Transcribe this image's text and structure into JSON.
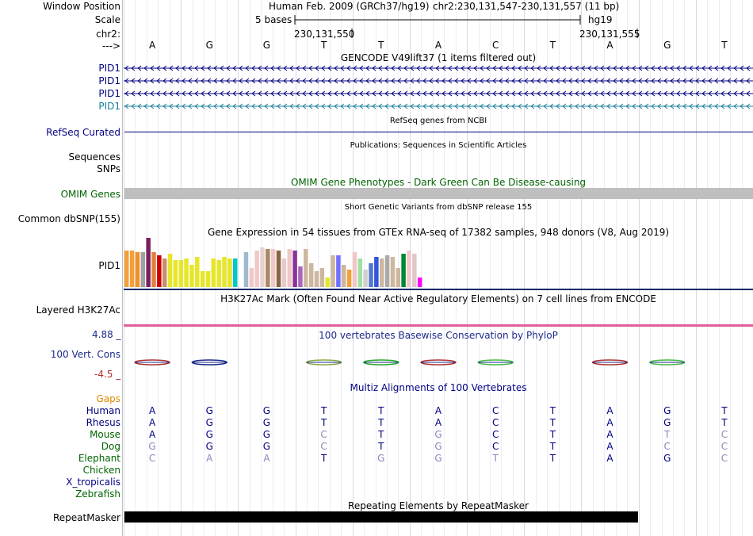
{
  "header": {
    "window_position_label": "Window Position",
    "scale_label": "Scale",
    "chrom_label": "chr2:",
    "arrow_label": "--->",
    "assembly_text": "Human Feb. 2009 (GRCh37/hg19)",
    "position_text": "chr2:230,131,547-230,131,557 (11 bp)",
    "scale_text": "5 bases",
    "assembly_short": "hg19",
    "coord_left": "230,131,550",
    "coord_right": "230,131,555"
  },
  "sequence": [
    "A",
    "G",
    "G",
    "T",
    "T",
    "A",
    "C",
    "T",
    "A",
    "G",
    "T"
  ],
  "tracks": {
    "gencode_title": "GENCODE V49lift37 (1 items filtered out)",
    "gencode_genes": [
      {
        "label": "PID1",
        "color": "#000080"
      },
      {
        "label": "PID1",
        "color": "#000080"
      },
      {
        "label": "PID1",
        "color": "#000080"
      },
      {
        "label": "PID1",
        "color": "#1b7f9a"
      }
    ],
    "refseq_title": "RefSeq genes from NCBI",
    "refseq_label": "RefSeq Curated",
    "pubs_title": "Publications: Sequences in Scientific Articles",
    "sequences_label": "Sequences",
    "snps_label": "SNPs",
    "omim_title": "OMIM Gene Phenotypes - Dark Green Can Be Disease-causing",
    "omim_label": "OMIM Genes",
    "dbsnp_title": "Short Genetic Variants from dbSNP release 155",
    "dbsnp_label": "Common dbSNP(155)",
    "gtex_title": "Gene Expression in 54 tissues from GTEx RNA-seq of 17382 samples, 948 donors (V8, Aug 2019)",
    "gtex_label": "PID1",
    "h3k_title": "H3K27Ac Mark (Often Found Near Active Regulatory Elements) on 7 cell lines from ENCODE",
    "h3k_label": "Layered H3K27Ac",
    "phylop_title": "100 vertebrates Basewise Conservation by PhyloP",
    "phylop_label": "100 Vert. Cons",
    "phylop_max": "4.88 _",
    "phylop_min": "-4.5 _",
    "multiz_title": "Multiz Alignments of 100 Vertebrates",
    "gaps_label": "Gaps",
    "repeat_title": "Repeating Elements by RepeatMasker",
    "repeat_label": "RepeatMasker"
  },
  "gtex_heights": [
    46,
    46,
    44,
    44,
    62,
    44,
    40,
    36,
    42,
    34,
    34,
    36,
    28,
    38,
    20,
    20,
    36,
    34,
    38,
    36,
    36,
    34,
    44,
    24,
    46,
    50,
    48,
    48,
    46,
    36,
    48,
    46,
    26,
    48,
    30,
    20,
    24,
    12,
    40,
    40,
    28,
    22,
    44,
    36,
    22,
    30,
    38,
    36,
    40,
    38,
    24,
    42,
    46,
    42,
    12
  ],
  "gtex_colors": [
    "#f4a03a",
    "#f4a03a",
    "#f09030",
    "#a0a0a0",
    "#7a1f5f",
    "#e08040",
    "#cc0000",
    "#c88f6e",
    "#e6e62a",
    "#e6e62a",
    "#e6e62a",
    "#e6e62a",
    "#e6e62a",
    "#e6e62a",
    "#e6e62a",
    "#e6e62a",
    "#e6e62a",
    "#e6e62a",
    "#e6e62a",
    "#e6e62a",
    "#00c8c8",
    "#ffffff",
    "#a0b8d0",
    "#f0c8c8",
    "#f0c8c8",
    "#e8d0d0",
    "#aa8866",
    "#f0c8c8",
    "#886644",
    "#e8c8c8",
    "#f0c8c8",
    "#883399",
    "#aa66bb",
    "#cdb79e",
    "#cdb79e",
    "#cdb79e",
    "#cdb79e",
    "#e6e62a",
    "#cdb79e",
    "#7070ff",
    "#cdb79e",
    "#f4a03a",
    "#f0c8c8",
    "#a0e0a0",
    "#d0d0d0",
    "#5577cc",
    "#3355dd",
    "#cdb79e",
    "#aaaaaa",
    "#cdb79e",
    "#cdb79e",
    "#008833",
    "#f0c8c8",
    "#e0c8c8",
    "#ff00ff"
  ],
  "species": [
    {
      "name": "Human",
      "color": "#000080",
      "bases": [
        "A",
        "G",
        "G",
        "T",
        "T",
        "A",
        "C",
        "T",
        "A",
        "G",
        "T"
      ],
      "dim": [
        0,
        0,
        0,
        0,
        0,
        0,
        0,
        0,
        0,
        0,
        0
      ]
    },
    {
      "name": "Rhesus",
      "color": "#000080",
      "bases": [
        "A",
        "G",
        "G",
        "T",
        "T",
        "A",
        "C",
        "T",
        "A",
        "G",
        "T"
      ],
      "dim": [
        0,
        0,
        0,
        0,
        0,
        0,
        0,
        0,
        0,
        0,
        0
      ]
    },
    {
      "name": "Mouse",
      "color": "#006400",
      "bases": [
        "A",
        "G",
        "G",
        "C",
        "T",
        "G",
        "C",
        "T",
        "A",
        "T",
        "C"
      ],
      "dim": [
        0,
        0,
        0,
        1,
        0,
        1,
        0,
        0,
        0,
        1,
        1
      ]
    },
    {
      "name": "Dog",
      "color": "#006400",
      "bases": [
        "G",
        "G",
        "G",
        "C",
        "T",
        "G",
        "C",
        "T",
        "A",
        "C",
        "C"
      ],
      "dim": [
        1,
        0,
        0,
        1,
        0,
        1,
        0,
        0,
        0,
        1,
        1
      ]
    },
    {
      "name": "Elephant",
      "color": "#006400",
      "bases": [
        "C",
        "A",
        "A",
        "T",
        "G",
        "G",
        "T",
        "T",
        "A",
        "G",
        "C"
      ],
      "dim": [
        1,
        1,
        1,
        0,
        1,
        1,
        1,
        0,
        0,
        0,
        1
      ]
    },
    {
      "name": "Chicken",
      "color": "#006400",
      "bases": [],
      "dim": []
    },
    {
      "name": "X_tropicalis",
      "color": "#000080",
      "bases": [],
      "dim": []
    },
    {
      "name": "Zebrafish",
      "color": "#006400",
      "bases": [],
      "dim": []
    }
  ],
  "colors": {
    "dark_blue": "#000080",
    "dark_green": "#006400",
    "gaps_orange": "#e08a00",
    "phylop_blue": "#1b2a8a",
    "phylop_red": "#b03030",
    "dim_base": "#8888bb"
  }
}
